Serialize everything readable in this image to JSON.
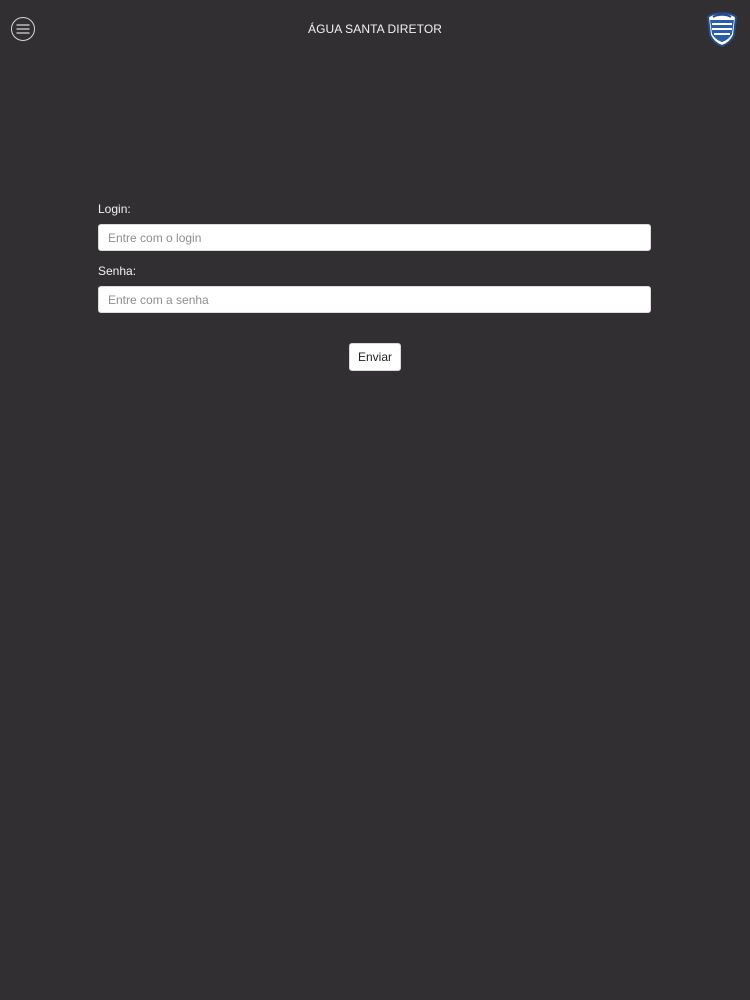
{
  "header": {
    "title": "ÁGUA SANTA DIRETOR",
    "menu_icon": "menu-circle-icon",
    "crest_icon": "club-crest-icon"
  },
  "form": {
    "login_label": "Login:",
    "login_placeholder": "Entre com o login",
    "senha_label": "Senha:",
    "senha_placeholder": "Entre com a senha",
    "submit_label": "Enviar"
  },
  "theme": {
    "background": "#312f32",
    "field_background": "#ffffff",
    "button_background": "#ffffff",
    "text": "#ffffff"
  }
}
